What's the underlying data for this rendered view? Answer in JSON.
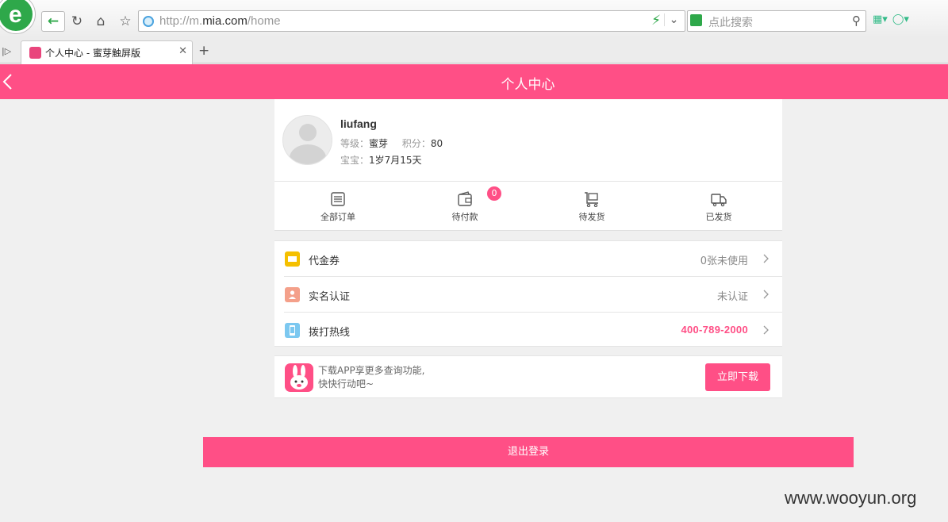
{
  "browser": {
    "url_prefix": "http://m.",
    "url_domain": "mia.com",
    "url_path": "/home",
    "search_placeholder": "点此搜索",
    "tab_title": "个人中心 - 蜜芽触屏版",
    "logo_letter": "e"
  },
  "header": {
    "title": "个人中心"
  },
  "profile": {
    "username": "liufang",
    "level_label": "等级：",
    "level_value": "蜜芽",
    "points_label": "积分：",
    "points_value": "80",
    "baby_label": "宝宝：",
    "baby_value": "1岁7月15天"
  },
  "orders": [
    {
      "label": "全部订单",
      "icon": "list-icon"
    },
    {
      "label": "待付款",
      "icon": "wallet-icon",
      "badge": "0"
    },
    {
      "label": "待发货",
      "icon": "cart-icon"
    },
    {
      "label": "已发货",
      "icon": "truck-icon"
    }
  ],
  "menu": [
    {
      "label": "代金券",
      "value": "0张未使用",
      "icon": "coupon-icon",
      "color": "#f5c000"
    },
    {
      "label": "实名认证",
      "value": "未认证",
      "icon": "id-icon",
      "color": "#f4a08a"
    },
    {
      "label": "拨打热线",
      "value": "400-789-2000",
      "icon": "phone-icon",
      "color": "#7cc8f0"
    }
  ],
  "app_banner": {
    "line1": "下载APP享更多查询功能,",
    "line2": "快快行动吧~",
    "button": "立即下载"
  },
  "logout": "退出登录",
  "watermark": "www.wooyun.org",
  "colors": {
    "brand": "#ff4f86"
  }
}
